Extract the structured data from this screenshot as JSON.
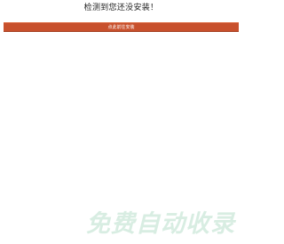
{
  "notice": {
    "text": "检测到您还没安装！"
  },
  "install_button": {
    "label": "点此前往安装"
  },
  "watermark": {
    "text": "免费自动收录"
  },
  "colors": {
    "button_background": "#c8502c",
    "watermark": "#d8ede2"
  }
}
